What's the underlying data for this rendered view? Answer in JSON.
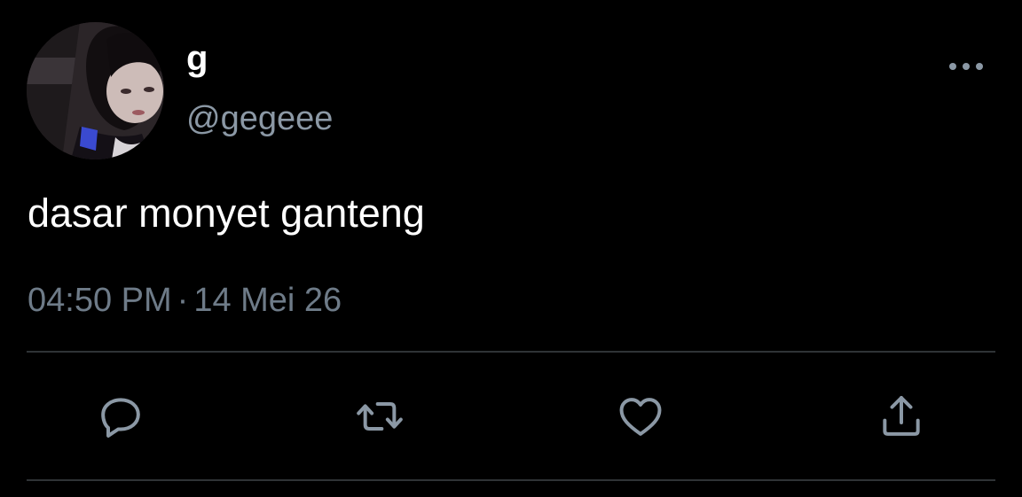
{
  "user": {
    "display_name": "g",
    "handle": "@gegeee",
    "avatar_icon": "profile-photo"
  },
  "tweet": {
    "text": "dasar monyet ganteng",
    "time": "04:50 PM",
    "separator": "·",
    "date": "14 Mei 26"
  },
  "actions": {
    "more_icon": "more-horizontal-icon",
    "reply_icon": "reply-icon",
    "retweet_icon": "retweet-icon",
    "like_icon": "heart-icon",
    "share_icon": "share-icon"
  },
  "colors": {
    "background": "#000000",
    "primary_text": "#ffffff",
    "secondary_text": "#8b98a5",
    "icon": "#8b98a5",
    "divider": "#2f3336"
  }
}
